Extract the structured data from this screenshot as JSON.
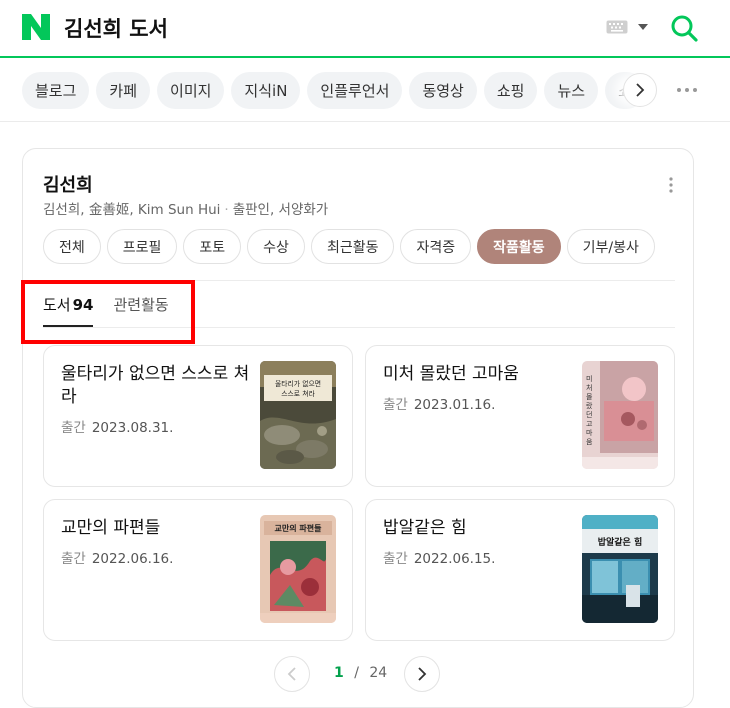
{
  "header": {
    "search_query": "김선희 도서",
    "icons": {
      "logo": "naver-logo",
      "keyboard": "keyboard-icon",
      "dropdown": "caret-down-icon",
      "search": "search-icon"
    },
    "brand_color": "#03c75a"
  },
  "nav": {
    "items": [
      "블로그",
      "카페",
      "이미지",
      "지식iN",
      "인플루언서",
      "동영상",
      "쇼핑",
      "뉴스",
      "쇼"
    ]
  },
  "profile": {
    "name": "김선희",
    "aliases": "김선희, 金善姬, Kim Sun Hui",
    "roles": "출판인, 서양화가"
  },
  "category_tabs": {
    "items": [
      "전체",
      "프로필",
      "포토",
      "수상",
      "최근활동",
      "자격증",
      "작품활동",
      "기부/봉사"
    ],
    "active": "작품활동",
    "active_color": "#b0847a"
  },
  "sub_tabs": {
    "books_label": "도서",
    "books_count": "94",
    "related_label": "관련활동"
  },
  "books": [
    {
      "title": "울타리가 없으면 스스로 쳐라",
      "date_label": "출간",
      "date": "2023.08.31.",
      "cover_text": "울타리가 없으면 스스로 쳐라"
    },
    {
      "title": "미처 몰랐던 고마움",
      "date_label": "출간",
      "date": "2023.01.16.",
      "cover_text": "미처 몰랐던 고마움"
    },
    {
      "title": "교만의 파편들",
      "date_label": "출간",
      "date": "2022.06.16.",
      "cover_text": "교만의 파편들"
    },
    {
      "title": "밥알같은 힘",
      "date_label": "출간",
      "date": "2022.06.15.",
      "cover_text": "밥알같은 힘"
    }
  ],
  "pagination": {
    "current": "1",
    "separator": "/",
    "total": "24"
  },
  "highlight_color": "#ff0000"
}
